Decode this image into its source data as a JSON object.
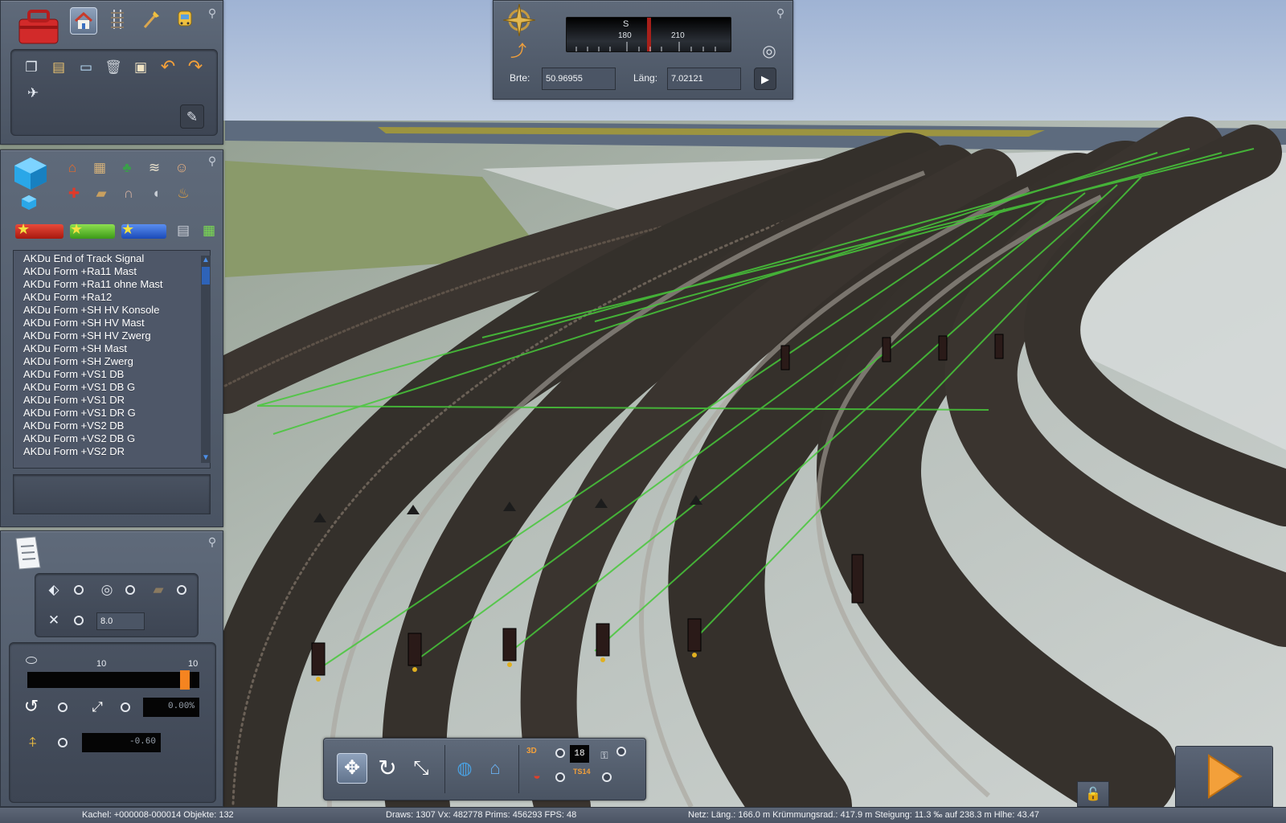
{
  "object_list": {
    "items": [
      "AKDu End of Track Signal",
      "AKDu Form +Ra11 Mast",
      "AKDu Form +Ra11 ohne Mast",
      "AKDu Form +Ra12",
      "AKDu Form +SH HV Konsole",
      "AKDu Form +SH HV Mast",
      "AKDu Form +SH HV Zwerg",
      "AKDu Form +SH Mast",
      "AKDu Form +SH Zwerg",
      "AKDu Form +VS1 DB",
      "AKDu Form +VS1 DB G",
      "AKDu Form +VS1 DR",
      "AKDu Form +VS1 DR G",
      "AKDu Form +VS2 DB",
      "AKDu Form +VS2 DB G",
      "AKDu Form +VS2 DR"
    ]
  },
  "compass": {
    "heading_letter": "S",
    "tick_180": "180",
    "tick_210": "210"
  },
  "coordinates": {
    "lat_label": "Brte:",
    "lat_value": "50.96955",
    "lon_label": "Läng:",
    "lon_value": "7.02121"
  },
  "snap_panel": {
    "grid_value": "8.0"
  },
  "brush_panel": {
    "size_min_label": "10",
    "size_max_label": "10",
    "size_fill_fraction": 0.94,
    "rotation_value": "0.00%",
    "height_value": "-0.60"
  },
  "bottom_toolbar": {
    "counter_value": "18",
    "label_3d": "3D",
    "label_ts14": "TS14"
  },
  "status_bar": {
    "tile": "Kachel: +000008-000014  Objekte: 132",
    "render": "Draws: 1307 Vx: 482778 Prims: 456293 FPS: 48",
    "net": "Netz:  Läng.:  166.0 m Krümmungsrad.: 417.9 m Steigung: 11.3 ‰ auf 238.3 m Hlhe:  43.47"
  },
  "colors": {
    "panel": "#56606f",
    "status_bar": "#525b6a",
    "drive_arrow": "#f3a03a",
    "link_lines": "#47c83a",
    "list_scroll": "#2e63b8"
  },
  "icons": {
    "toolbox": "toolbox-icon",
    "home": "home-icon",
    "track": "track-icon",
    "paint": "paint-brush-icon",
    "train": "train-icon",
    "pin": "pin-icon",
    "compass": "compass-rose-icon",
    "drive": "play-arrow-icon"
  }
}
